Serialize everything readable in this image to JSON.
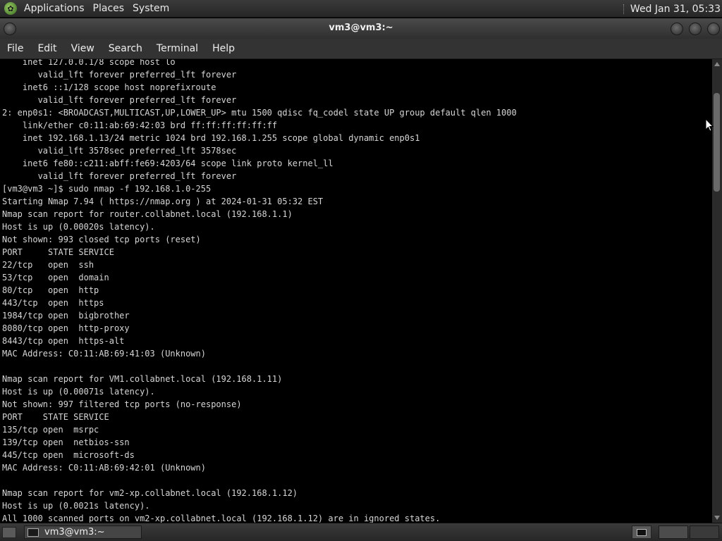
{
  "top_panel": {
    "logo_icon": "gnome-foot-icon",
    "menus": [
      "Applications",
      "Places",
      "System"
    ],
    "clock": "Wed Jan 31, 05:33"
  },
  "window": {
    "title": "vm3@vm3:~"
  },
  "menubar": {
    "items": [
      "File",
      "Edit",
      "View",
      "Search",
      "Terminal",
      "Help"
    ]
  },
  "terminal": {
    "lines": [
      "    inet 127.0.0.1/8 scope host lo",
      "       valid_lft forever preferred_lft forever",
      "    inet6 ::1/128 scope host noprefixroute",
      "       valid_lft forever preferred_lft forever",
      "2: enp0s1: <BROADCAST,MULTICAST,UP,LOWER_UP> mtu 1500 qdisc fq_codel state UP group default qlen 1000",
      "    link/ether c0:11:ab:69:42:03 brd ff:ff:ff:ff:ff:ff",
      "    inet 192.168.1.13/24 metric 1024 brd 192.168.1.255 scope global dynamic enp0s1",
      "       valid_lft 3578sec preferred_lft 3578sec",
      "    inet6 fe80::c211:abff:fe69:4203/64 scope link proto kernel_ll",
      "       valid_lft forever preferred_lft forever",
      "[vm3@vm3 ~]$ sudo nmap -f 192.168.1.0-255",
      "Starting Nmap 7.94 ( https://nmap.org ) at 2024-01-31 05:32 EST",
      "Nmap scan report for router.collabnet.local (192.168.1.1)",
      "Host is up (0.00020s latency).",
      "Not shown: 993 closed tcp ports (reset)",
      "PORT     STATE SERVICE",
      "22/tcp   open  ssh",
      "53/tcp   open  domain",
      "80/tcp   open  http",
      "443/tcp  open  https",
      "1984/tcp open  bigbrother",
      "8080/tcp open  http-proxy",
      "8443/tcp open  https-alt",
      "MAC Address: C0:11:AB:69:41:03 (Unknown)",
      "",
      "Nmap scan report for VM1.collabnet.local (192.168.1.11)",
      "Host is up (0.00071s latency).",
      "Not shown: 997 filtered tcp ports (no-response)",
      "PORT    STATE SERVICE",
      "135/tcp open  msrpc",
      "139/tcp open  netbios-ssn",
      "445/tcp open  microsoft-ds",
      "MAC Address: C0:11:AB:69:42:01 (Unknown)",
      "",
      "Nmap scan report for vm2-xp.collabnet.local (192.168.1.12)",
      "Host is up (0.0021s latency).",
      "All 1000 scanned ports on vm2-xp.collabnet.local (192.168.1.12) are in ignored states."
    ]
  },
  "bottom_panel": {
    "task_label": "vm3@vm3:~",
    "task_icon": "terminal-icon",
    "tray_icon": "terminal-icon"
  }
}
